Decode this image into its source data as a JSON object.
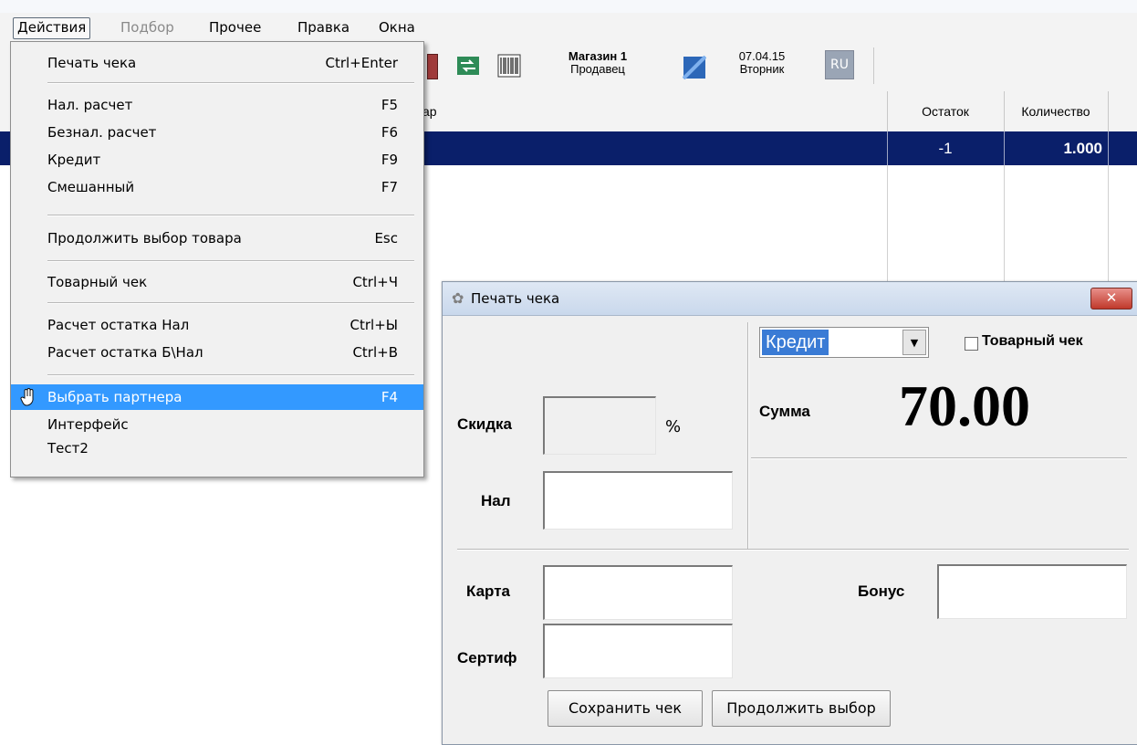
{
  "menubar": {
    "items": [
      {
        "label": "Действия",
        "state": "active"
      },
      {
        "label": "Подбор",
        "state": "disabled"
      },
      {
        "label": "Прочее",
        "state": "normal"
      },
      {
        "label": "Правка",
        "state": "normal"
      },
      {
        "label": "Окна",
        "state": "normal"
      }
    ]
  },
  "toolbar": {
    "store_name": "Магазин 1",
    "role": "Продавец",
    "date": "07.04.15",
    "weekday": "Вторник",
    "lang": "RU"
  },
  "grid": {
    "headers": {
      "product": "ар",
      "stock": "Остаток",
      "quantity": "Количество"
    },
    "selected_row": {
      "stock": "-1",
      "quantity": "1.000"
    },
    "colors": {
      "selected_bg": "#0a1f6a"
    }
  },
  "dropdown_menu": {
    "items": [
      {
        "label": "Печать чека",
        "shortcut": "Ctrl+Enter"
      },
      {
        "label": "Нал. расчет",
        "shortcut": "F5"
      },
      {
        "label": "Безнал. расчет",
        "shortcut": "F6"
      },
      {
        "label": "Кредит",
        "shortcut": "F9"
      },
      {
        "label": "Смешанный",
        "shortcut": "F7"
      },
      {
        "label": "Продолжить выбор товара",
        "shortcut": "Esc"
      },
      {
        "label": "Товарный чек",
        "shortcut": "Ctrl+Ч"
      },
      {
        "label": "Расчет остатка Нал",
        "shortcut": "Ctrl+Ы"
      },
      {
        "label": "Расчет остатка Б\\Нал",
        "shortcut": "Ctrl+В"
      },
      {
        "label": "Выбрать партнера",
        "shortcut": "F4",
        "selected": true,
        "icon": "hand-cursor-icon"
      },
      {
        "label": "Интерфейс",
        "shortcut": ""
      },
      {
        "label": "Тест2",
        "shortcut": ""
      }
    ],
    "colors": {
      "selected_bg": "#3399ff"
    }
  },
  "dialog": {
    "title": "Печать чека",
    "close_label": "✕",
    "payment_type": "Кредит",
    "receipt_checkbox_label": "Товарный чек",
    "receipt_checked": false,
    "sum_label": "Сумма",
    "sum_value": "70.00",
    "discount_label": "Скидка",
    "discount_value": "",
    "percent_sign": "%",
    "cash_label": "Нал",
    "cash_value": "",
    "card_label": "Карта",
    "card_value": "",
    "bonus_label": "Бонус",
    "bonus_value": "",
    "certificate_label": "Сертиф",
    "certificate_value": "",
    "save_button": "Сохранить чек",
    "continue_button": "Продолжить выбор"
  }
}
